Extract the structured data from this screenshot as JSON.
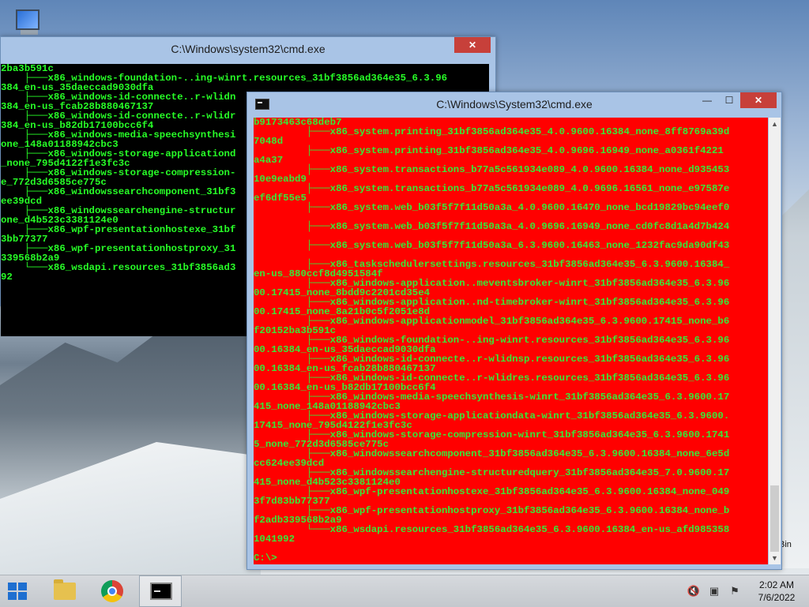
{
  "desktop": {
    "recycle_bin_label": "Bin"
  },
  "window_back": {
    "title": "C:\\Windows\\system32\\cmd.exe",
    "lines": [
      "2ba3b591c",
      "    ├───x86_windows-foundation-..ing-winrt.resources_31bf3856ad364e35_6.3.96",
      "384_en-us_35daeccad9030dfa",
      "    ├───x86_windows-id-connecte..r-wlidn",
      "384_en-us_fcab28b880467137",
      "    ├───x86_windows-id-connecte..r-wlidr",
      "384_en-us_b82db17100bcc6f4",
      "    ├───x86_windows-media-speechsynthesi",
      "one_148a01188942cbc3",
      "    ├───x86_windows-storage-applicationd",
      "_none_795d4122f1e3fc3c",
      "    ├───x86_windows-storage-compression-",
      "e_772d3d6585ce775c",
      "    ├───x86_windowssearchcomponent_31bf3",
      "ee39dcd",
      "    ├───x86_windowssearchengine-structur",
      "one_d4b523c3381124e0",
      "    ├───x86_wpf-presentationhostexe_31bf",
      "3bb77377",
      "    ├───x86_wpf-presentationhostproxy_31",
      "339568b2a9",
      "    └───x86_wsdapi.resources_31bf3856ad3",
      "92"
    ]
  },
  "window_front": {
    "title": "C:\\Windows\\System32\\cmd.exe",
    "lines": [
      "b9173463c68deb7",
      "         ├───x86_system.printing_31bf3856ad364e35_4.0.9600.16384_none_8ff8769a39d",
      "7048d",
      "         ├───x86_system.printing_31bf3856ad364e35_4.0.9696.16949_none_a0361f4221",
      "a4a37",
      "         ├───x86_system.transactions_b77a5c561934e089_4.0.9600.16384_none_d935453",
      "10e9eabd9",
      "         ├───x86_system.transactions_b77a5c561934e089_4.0.9696.16561_none_e97587e",
      "ef6df55e5",
      "         ├───x86_system.web_b03f5f7f11d50a3a_4.0.9600.16470_none_bcd19829bc94eef0",
      "",
      "         ├───x86_system.web_b03f5f7f11d50a3a_4.0.9696.16949_none_cd0fc8d1a4d7b424",
      "",
      "         ├───x86_system.web_b03f5f7f11d50a3a_6.3.9600.16463_none_1232fac9da90df43",
      "",
      "         ├───x86_taskschedulersettings.resources_31bf3856ad364e35_6.3.9600.16384_",
      "en-us_880ccf8d4951584f",
      "         ├───x86_windows-application..meventsbroker-winrt_31bf3856ad364e35_6.3.96",
      "00.17415_none_8bdd9c2201cd35e4",
      "         ├───x86_windows-application..nd-timebroker-winrt_31bf3856ad364e35_6.3.96",
      "00.17415_none_8a21b0c5f2051e8d",
      "         ├───x86_windows-applicationmodel_31bf3856ad364e35_6.3.9600.17415_none_b6",
      "f20152ba3b591c",
      "         ├───x86_windows-foundation-..ing-winrt.resources_31bf3856ad364e35_6.3.96",
      "00.16384_en-us_35daeccad9030dfa",
      "         ├───x86_windows-id-connecte..r-wlidnsp.resources_31bf3856ad364e35_6.3.96",
      "00.16384_en-us_fcab28b880467137",
      "         ├───x86_windows-id-connecte..r-wlidres.resources_31bf3856ad364e35_6.3.96",
      "00.16384_en-us_b82db17100bcc6f4",
      "         ├───x86_windows-media-speechsynthesis-winrt_31bf3856ad364e35_6.3.9600.17",
      "415_none_148a01188942cbc3",
      "         ├───x86_windows-storage-applicationdata-winrt_31bf3856ad364e35_6.3.9600.",
      "17415_none_795d4122f1e3fc3c",
      "         ├───x86_windows-storage-compression-winrt_31bf3856ad364e35_6.3.9600.1741",
      "5_none_772d3d6585ce775c",
      "         ├───x86_windowssearchcomponent_31bf3856ad364e35_6.3.9600.16384_none_6e5d",
      "cc624ee39dcd",
      "         ├───x86_windowssearchengine-structuredquery_31bf3856ad364e35_7.0.9600.17",
      "415_none_d4b523c3381124e0",
      "         ├───x86_wpf-presentationhostexe_31bf3856ad364e35_6.3.9600.16384_none_049",
      "3f7d83bb77377",
      "         ├───x86_wpf-presentationhostproxy_31bf3856ad364e35_6.3.9600.16384_none_b",
      "f2adb339568b2a9",
      "         └───x86_wsdapi.resources_31bf3856ad364e35_6.3.9600.16384_en-us_afd985358",
      "1041992",
      "",
      "C:\\>"
    ]
  },
  "taskbar": {
    "time": "2:02 AM",
    "date": "7/6/2022"
  }
}
